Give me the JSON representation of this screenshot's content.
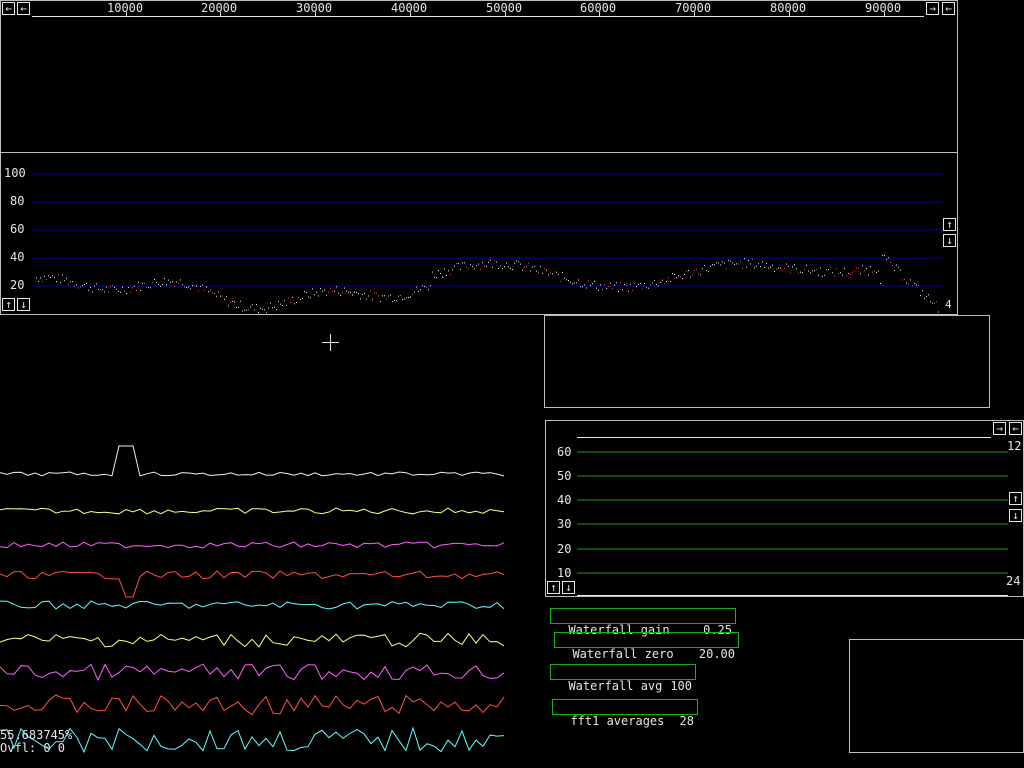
{
  "window": {
    "title": ""
  },
  "freq_scale": {
    "ticks": [
      "10000",
      "20000",
      "30000",
      "40000",
      "50000",
      "60000",
      "70000",
      "80000",
      "90000"
    ],
    "left_btn": "←",
    "right_btn": "→",
    "left2_btn": "←"
  },
  "spectrum": {
    "y_ticks": [
      "100",
      "80",
      "60",
      "40",
      "20"
    ],
    "up_btn": "↑",
    "down_btn": "↓",
    "left_up_btn": "↑",
    "left_down_btn": "↓",
    "zoom_value": "4"
  },
  "small_wf": {
    "y_ticks": [
      "60",
      "50",
      "40",
      "30",
      "20",
      "10"
    ],
    "right_top_value": "12",
    "right_bottom_value": "24",
    "right_btn": "→",
    "left_btn": "←",
    "up_btn": "↑",
    "down_btn": "↓",
    "bottom_up_btn": "↑",
    "bottom_down_btn": "↓"
  },
  "params": {
    "wf_gain_label": "Waterfall gain",
    "wf_gain_value": "0.25",
    "wf_zero_label": "Waterfall zero",
    "wf_zero_value": "20.00",
    "wf_avg_label": "Waterfall avg",
    "wf_avg_value": "100",
    "fft1_avg_label": "fft1 averages",
    "fft1_avg_value": "28"
  },
  "status": {
    "percent": "55.683745%",
    "ovfl": "Ovfl: 0 0"
  },
  "colors": {
    "grid_blue": "#0000b4",
    "grid_green": "#1a9a1a",
    "param_border": "#19b319",
    "trace_colors": [
      "#f0f0f0",
      "#ffff80",
      "#ff60ff",
      "#ff5040",
      "#60ffff",
      "#ffff80",
      "#ff60ff",
      "#ff5040",
      "#60ffff"
    ]
  }
}
